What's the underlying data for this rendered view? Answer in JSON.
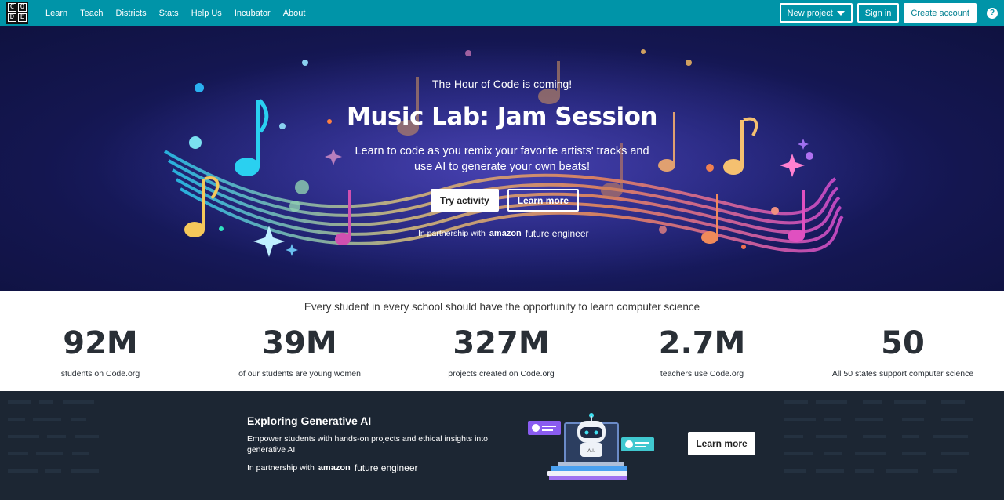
{
  "nav": {
    "logo_letters": [
      "C",
      "O",
      "D",
      "E"
    ],
    "links": [
      "Learn",
      "Teach",
      "Districts",
      "Stats",
      "Help Us",
      "Incubator",
      "About"
    ],
    "new_project": "New project",
    "sign_in": "Sign in",
    "create_account": "Create account",
    "help": "?"
  },
  "hero": {
    "eyebrow": "The Hour of Code is coming!",
    "title": "Music Lab: Jam Session",
    "description": "Learn to code as you remix your favorite artists' tracks and use AI to generate your own beats!",
    "try_button": "Try activity",
    "learn_button": "Learn more",
    "partner_prefix": "In partnership with",
    "partner_amazon": "amazon",
    "partner_name": "future engineer"
  },
  "stats": {
    "headline": "Every student in every school should have the opportunity to learn computer science",
    "items": [
      {
        "value": "92M",
        "label": "students on Code.org"
      },
      {
        "value": "39M",
        "label": "of our students are young women"
      },
      {
        "value": "327M",
        "label": "projects created on Code.org"
      },
      {
        "value": "2.7M",
        "label": "teachers use Code.org"
      },
      {
        "value": "50",
        "label": "All 50 states support computer science"
      }
    ]
  },
  "ai_section": {
    "title": "Exploring Generative AI",
    "description": "Empower students with hands-on projects and ethical insights into generative AI",
    "partner_prefix": "In partnership with",
    "partner_amazon": "amazon",
    "partner_name": "future engineer",
    "robot_label": "A.I.",
    "learn_button": "Learn more"
  },
  "colors": {
    "nav_bg": "#0094a8",
    "hero_bg": "#1b1f6e",
    "ai_bg": "#1c2633"
  }
}
